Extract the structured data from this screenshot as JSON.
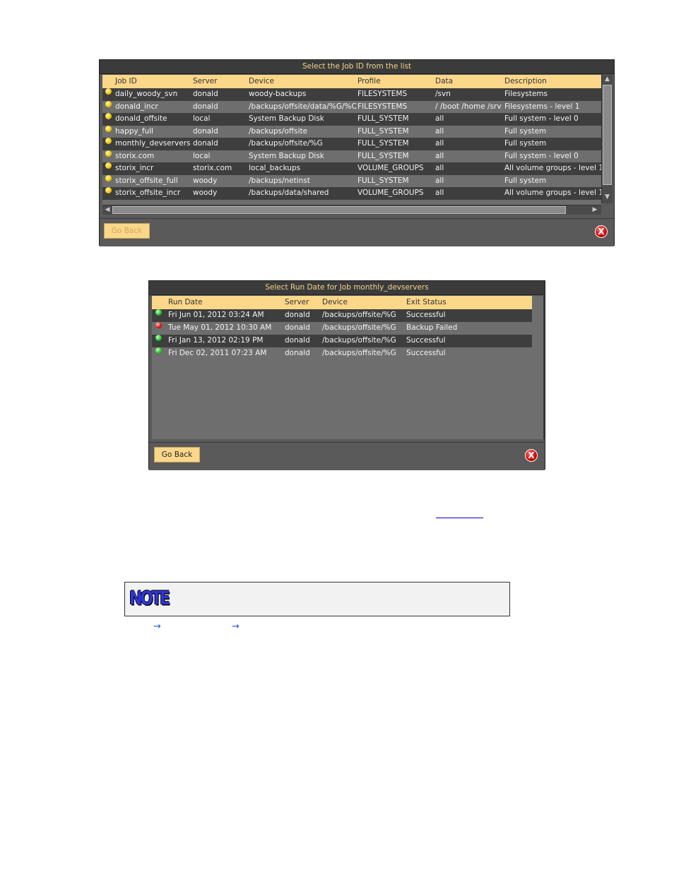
{
  "job_dialog": {
    "title": "Select the Job ID from the list",
    "columns": [
      "Job ID",
      "Server",
      "Device",
      "Profile",
      "Data",
      "Description"
    ],
    "rows": [
      {
        "job_id": "daily_woody_svn",
        "server": "donald",
        "device": "woody-backups",
        "profile": "FILESYSTEMS",
        "data": "/svn",
        "description": "Filesystems"
      },
      {
        "job_id": "donald_incr",
        "server": "donald",
        "device": "/backups/offsite/data/%G/%C",
        "profile": "FILESYSTEMS",
        "data": "/ /boot /home /srv",
        "description": "Filesystems - level 1"
      },
      {
        "job_id": "donald_offsite",
        "server": "local",
        "device": "System Backup Disk",
        "profile": "FULL_SYSTEM",
        "data": "all",
        "description": "Full system - level 0"
      },
      {
        "job_id": "happy_full",
        "server": "donald",
        "device": "/backups/offsite",
        "profile": "FULL_SYSTEM",
        "data": "all",
        "description": "Full system"
      },
      {
        "job_id": "monthly_devservers",
        "server": "donald",
        "device": "/backups/offsite/%G",
        "profile": "FULL_SYSTEM",
        "data": "all",
        "description": "Full system"
      },
      {
        "job_id": "storix.com",
        "server": "local",
        "device": "System Backup Disk",
        "profile": "FULL_SYSTEM",
        "data": "all",
        "description": "Full system - level 0"
      },
      {
        "job_id": "storix_incr",
        "server": "storix.com",
        "device": "local_backups",
        "profile": "VOLUME_GROUPS",
        "data": "all",
        "description": "All volume groups - level 1"
      },
      {
        "job_id": "storix_offsite_full",
        "server": "woody",
        "device": "/backups/netinst",
        "profile": "FULL_SYSTEM",
        "data": "all",
        "description": "Full system"
      },
      {
        "job_id": "storix_offsite_incr",
        "server": "woody",
        "device": "/backups/data/shared",
        "profile": "VOLUME_GROUPS",
        "data": "all",
        "description": "All volume groups - level 1"
      }
    ],
    "go_back_label": "Go Back",
    "close_icon": "X"
  },
  "run_dialog": {
    "title": "Select Run Date for Job monthly_devservers",
    "columns": [
      "Run Date",
      "Server",
      "Device",
      "Exit Status"
    ],
    "rows": [
      {
        "status_color": "green",
        "run_date": "Fri Jun 01, 2012 03:24 AM",
        "server": "donald",
        "device": "/backups/offsite/%G",
        "exit_status": "Successful"
      },
      {
        "status_color": "red",
        "run_date": "Tue May 01, 2012 10:30 AM",
        "server": "donald",
        "device": "/backups/offsite/%G",
        "exit_status": "Backup Failed"
      },
      {
        "status_color": "green",
        "run_date": "Fri Jan 13, 2012 02:19 PM",
        "server": "donald",
        "device": "/backups/offsite/%G",
        "exit_status": "Successful"
      },
      {
        "status_color": "green",
        "run_date": "Fri Dec 02, 2011 07:23 AM",
        "server": "donald",
        "device": "/backups/offsite/%G",
        "exit_status": "Successful"
      }
    ],
    "go_back_label": "Go Back",
    "close_icon": "X"
  },
  "note": {
    "logo_text": "NOTE"
  },
  "arrows": [
    "→",
    "→"
  ]
}
